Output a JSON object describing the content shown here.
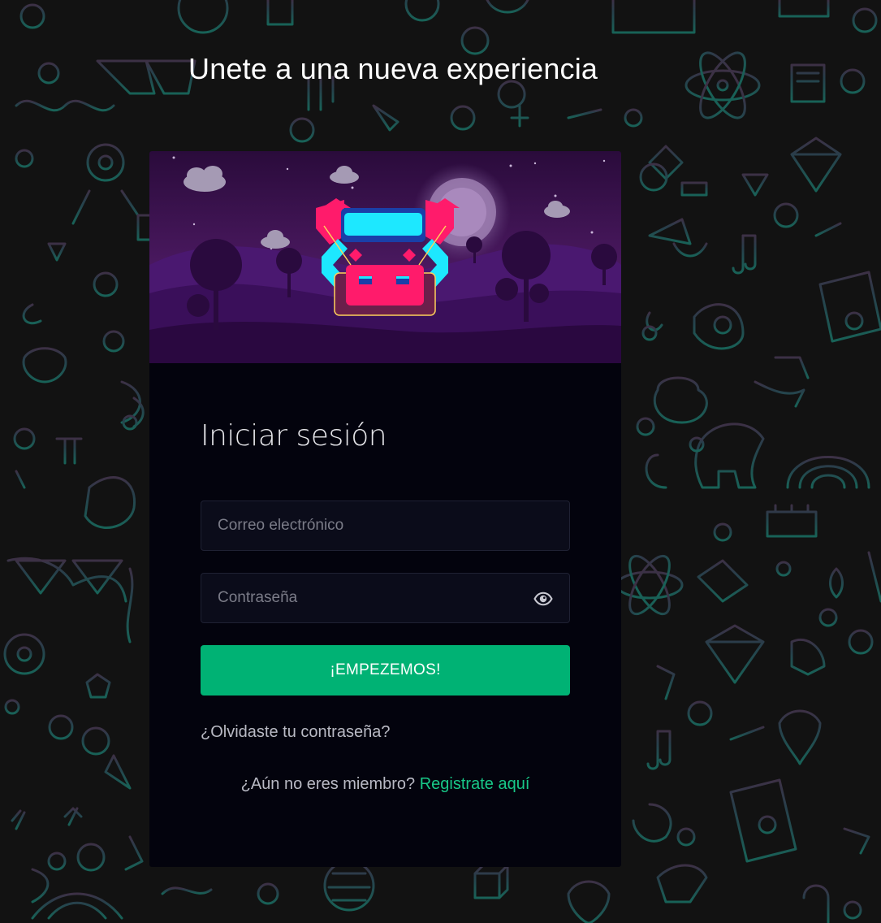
{
  "page": {
    "heading": "Unete a una nueva experiencia"
  },
  "login": {
    "title": "Iniciar sesión",
    "email_placeholder": "Correo electrónico",
    "password_placeholder": "Contraseña",
    "submit_label": "¡EMPEZEMOS!",
    "forgot_label": "¿Olvidaste tu contraseña?",
    "register_prompt": "¿Aún no eres miembro?",
    "register_link": "Registrate aquí"
  },
  "colors": {
    "background": "#121212",
    "card": "#03030d",
    "input_bg": "#0b0c1a",
    "accent_green": "#00b274",
    "link_green": "#18c888",
    "doodle_teal": "#1e6b68",
    "hero_purple": "#4a0f6b"
  },
  "icons": {
    "password_toggle": "eye-icon"
  }
}
